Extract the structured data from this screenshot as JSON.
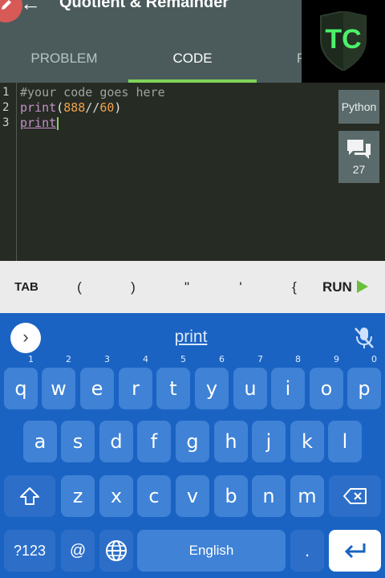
{
  "header": {
    "title": "Quotient & Remainder",
    "tabs": [
      {
        "label": "PROBLEM",
        "active": false
      },
      {
        "label": "CODE",
        "active": true
      },
      {
        "label": "R",
        "active": false
      }
    ],
    "logo_text": "TC",
    "accent_color": "#7fd45a"
  },
  "editor": {
    "lines": [
      {
        "num": "1",
        "text": "#your code goes here"
      },
      {
        "num": "2",
        "fn": "print",
        "open": "(",
        "num_a": "888",
        "op": "//",
        "num_b": "60",
        "close": ")"
      },
      {
        "num": "3",
        "fn": "print"
      }
    ],
    "language_label": "Python",
    "comments_count": "27"
  },
  "symbol_bar": {
    "tab": "TAB",
    "symbols": [
      "(",
      ")",
      "\"",
      "'",
      "{"
    ],
    "run": "RUN"
  },
  "keyboard": {
    "suggestion": "print",
    "row1": [
      {
        "k": "q",
        "h": "1"
      },
      {
        "k": "w",
        "h": "2"
      },
      {
        "k": "e",
        "h": "3"
      },
      {
        "k": "r",
        "h": "4"
      },
      {
        "k": "t",
        "h": "5"
      },
      {
        "k": "y",
        "h": "6"
      },
      {
        "k": "u",
        "h": "7"
      },
      {
        "k": "i",
        "h": "8"
      },
      {
        "k": "o",
        "h": "9"
      },
      {
        "k": "p",
        "h": "0"
      }
    ],
    "row2": [
      "a",
      "s",
      "d",
      "f",
      "g",
      "h",
      "j",
      "k",
      "l"
    ],
    "row3": [
      "z",
      "x",
      "c",
      "v",
      "b",
      "n",
      "m"
    ],
    "symbols_key": "?123",
    "at_key": "@",
    "space_label": "English",
    "period_key": "."
  }
}
